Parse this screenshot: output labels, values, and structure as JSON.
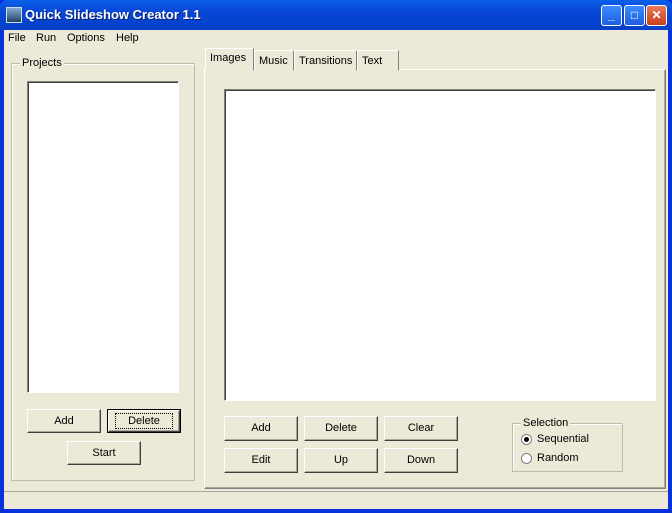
{
  "window": {
    "title": "Quick Slideshow Creator 1.1",
    "minimize": "_",
    "maximize": "□",
    "close": "✕"
  },
  "menu": [
    "File",
    "Run",
    "Options",
    "Help"
  ],
  "projects": {
    "label": "Projects",
    "items": [],
    "add": "Add",
    "delete": "Delete",
    "start": "Start"
  },
  "tabs": [
    {
      "label": "Images",
      "active": true
    },
    {
      "label": "Music"
    },
    {
      "label": "Transitions"
    },
    {
      "label": "Text"
    }
  ],
  "images": {
    "items": [],
    "buttons": {
      "add": "Add",
      "delete": "Delete",
      "clear": "Clear",
      "edit": "Edit",
      "up": "Up",
      "down": "Down"
    },
    "selection": {
      "label": "Selection",
      "options": [
        {
          "label": "Sequential",
          "checked": true
        },
        {
          "label": "Random",
          "checked": false
        }
      ]
    }
  },
  "status": ""
}
